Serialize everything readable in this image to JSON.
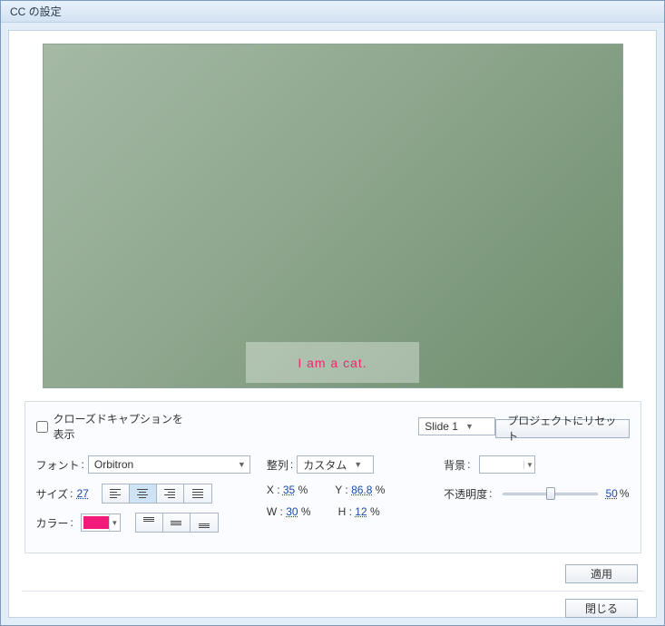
{
  "window": {
    "title": "CC の設定"
  },
  "preview": {
    "caption_text": "I am a cat."
  },
  "settings": {
    "show_cc_label": "クローズドキャプションを表示",
    "slide_selector": "Slide 1",
    "reset_label": "プロジェクトにリセット",
    "font_label": "フォント",
    "font_value": "Orbitron",
    "size_label": "サイズ",
    "size_value": "27",
    "color_label": "カラー",
    "color_value": "#f21a7a",
    "align_label": "整列",
    "align_value": "カスタム",
    "coords": {
      "x_label": "X",
      "x_value": "35",
      "x_unit": "%",
      "y_label": "Y",
      "y_value": "86.8",
      "y_unit": "%",
      "w_label": "W",
      "w_value": "30",
      "w_unit": "%",
      "h_label": "H",
      "h_value": "12",
      "h_unit": "%"
    },
    "bg_label": "背景",
    "opacity_label": "不透明度",
    "opacity_value": "50",
    "opacity_unit": "%"
  },
  "buttons": {
    "apply": "適用",
    "close": "閉じる"
  }
}
